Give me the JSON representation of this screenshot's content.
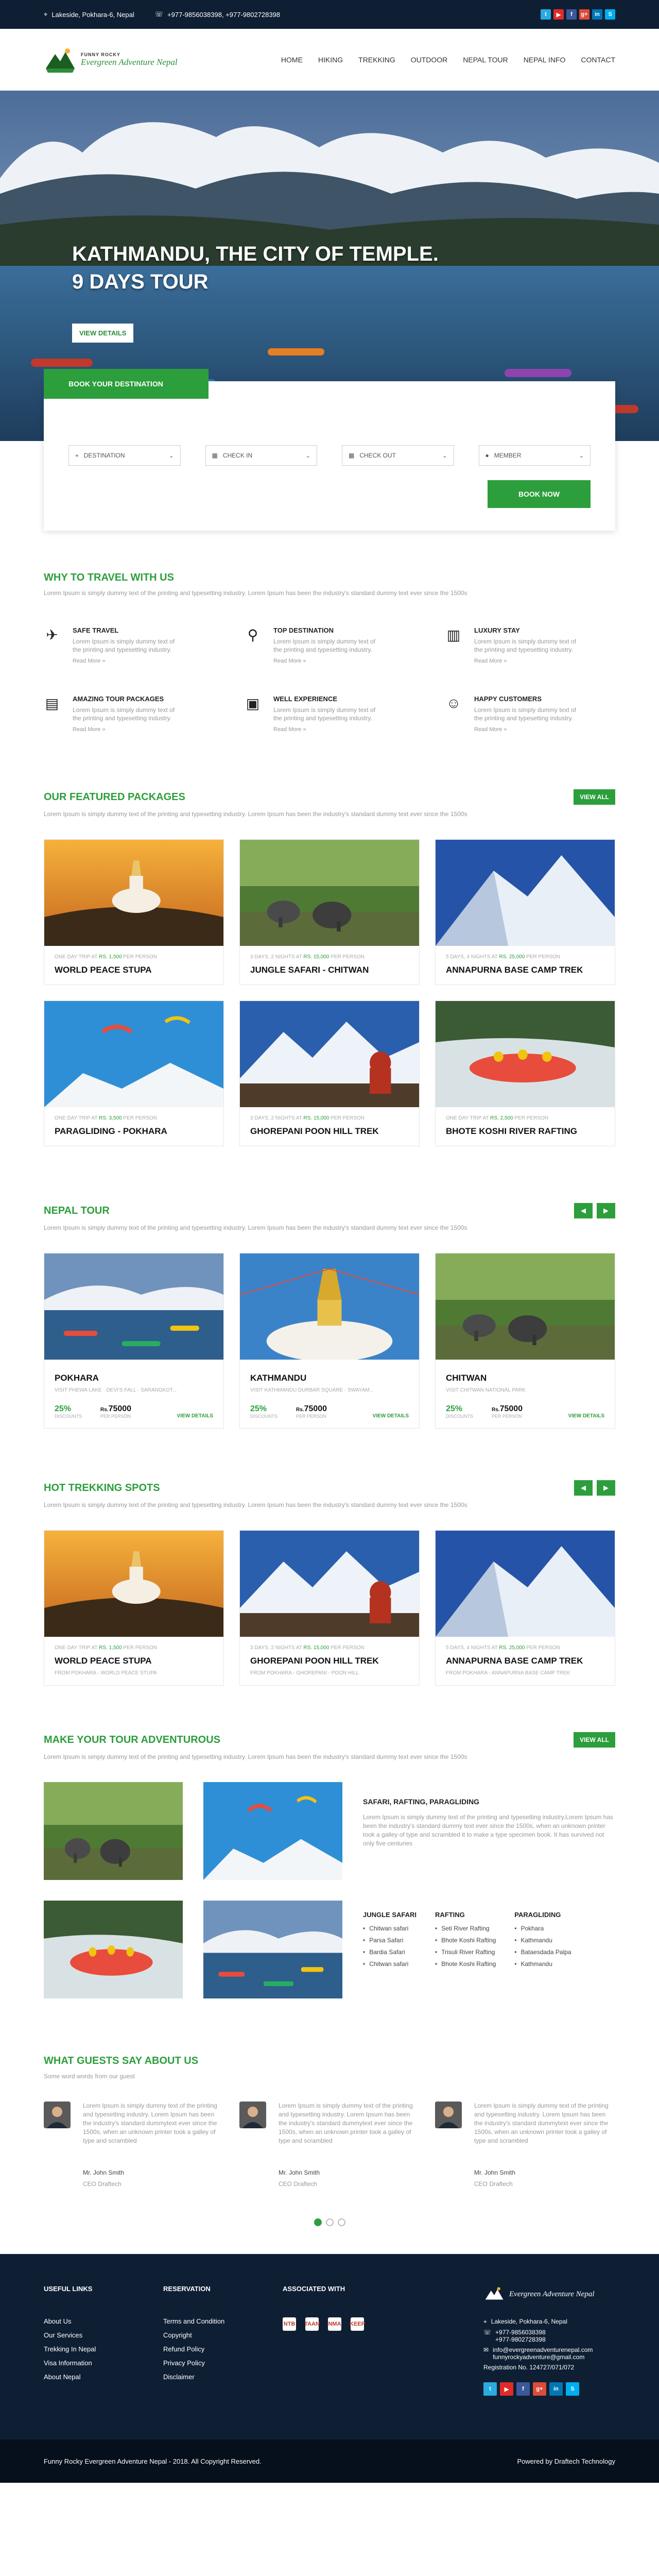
{
  "topbar": {
    "address": "Lakeside, Pokhara-6, Nepal",
    "phone": "+977-9856038398, +977-9802728398",
    "social": [
      {
        "icon": "twitter-icon",
        "glyph": "t",
        "color": "#2ba9e1"
      },
      {
        "icon": "youtube-icon",
        "glyph": "▶",
        "color": "#e12b28"
      },
      {
        "icon": "facebook-icon",
        "glyph": "f",
        "color": "#3b5998"
      },
      {
        "icon": "google-plus-icon",
        "glyph": "g+",
        "color": "#dd4b39"
      },
      {
        "icon": "linkedin-icon",
        "glyph": "in",
        "color": "#0077b5"
      },
      {
        "icon": "skype-icon",
        "glyph": "S",
        "color": "#00aff0"
      }
    ]
  },
  "nav": {
    "logo_text": "Evergreen Adventure Nepal",
    "logo_badge": "FUNNY ROCKY",
    "items": [
      "HOME",
      "HIKING",
      "TREKKING",
      "OUTDOOR",
      "NEPAL TOUR",
      "NEPAL INFO",
      "CONTACT"
    ]
  },
  "hero": {
    "title_line1": "KATHMANDU, THE CITY OF TEMPLE.",
    "title_line2": "9 DAYS TOUR",
    "button": "VIEW DETAILS"
  },
  "booking": {
    "tab": "BOOK YOUR DESTINATION",
    "fields": [
      {
        "label": "DESTINATION",
        "icon": "map-pin-icon",
        "glyph": "⌖"
      },
      {
        "label": "CHECK IN",
        "icon": "calendar-icon",
        "glyph": "▦"
      },
      {
        "label": "CHECK OUT",
        "icon": "calendar-icon",
        "glyph": "▦"
      },
      {
        "label": "MEMBER",
        "icon": "user-icon",
        "glyph": "●"
      }
    ],
    "button": "BOOK NOW"
  },
  "why": {
    "title": "WHY TO TRAVEL WITH US",
    "desc": "Lorem Ipsum is simply dummy text of the printing and typesetting industry. Lorem Ipsum has been the industry's standard dummy text ever since the 1500s",
    "items": [
      {
        "title": "SAFE TRAVEL",
        "icon": "airplane-icon",
        "glyph": "✈",
        "text": "Lorem Ipsum is simply dummy text of the printing and typesetting industry.",
        "more": "Read More »"
      },
      {
        "title": "TOP DESTINATION",
        "icon": "destination-pin-icon",
        "glyph": "⚲",
        "text": "Lorem Ipsum is simply dummy text of the printing and typesetting industry.",
        "more": "Read More »"
      },
      {
        "title": "LUXURY STAY",
        "icon": "building-icon",
        "glyph": "▥",
        "text": "Lorem Ipsum is simply dummy text of the printing and typesetting industry.",
        "more": "Read More »"
      },
      {
        "title": "AMAZING TOUR PACKAGES",
        "icon": "luggage-icon",
        "glyph": "▤",
        "text": "Lorem Ipsum is simply dummy text of the printing and typesetting industry.",
        "more": "Read More »"
      },
      {
        "title": "WELL EXPERIENCE",
        "icon": "certificate-icon",
        "glyph": "▣",
        "text": "Lorem Ipsum is simply dummy text of the printing and typesetting industry.",
        "more": "Read More »"
      },
      {
        "title": "HAPPY CUSTOMERS",
        "icon": "people-icon",
        "glyph": "☺",
        "text": "Lorem Ipsum is simply dummy text of the printing and typesetting industry.",
        "more": "Read More »"
      }
    ]
  },
  "featured": {
    "title": "OUR FEATURED PACKAGES",
    "view_all": "VIEW ALL",
    "desc": "Lorem Ipsum is simply dummy text of the printing and typesetting industry. Lorem Ipsum has been the industry's standard dummy text ever since the 1500s",
    "cards": [
      {
        "meta": "ONE DAY TRIP AT",
        "price": "RS. 1,500",
        "per": "PER PERSON",
        "title": "WORLD PEACE STUPA",
        "scene": "stupa"
      },
      {
        "meta": "3 DAYS, 2 NIGHTS AT",
        "price": "RS. 15,000",
        "per": "PER PERSON",
        "title": "JUNGLE SAFARI - CHITWAN",
        "scene": "jungle"
      },
      {
        "meta": "5 DAYS, 4 NIGHTS AT",
        "price": "RS. 25,000",
        "per": "PER PERSON",
        "title": "ANNAPURNA BASE CAMP TREK",
        "scene": "snow"
      },
      {
        "meta": "ONE DAY TRIP AT",
        "price": "RS. 3,500",
        "per": "PER PERSON",
        "title": "PARAGLIDING - POKHARA",
        "scene": "paraglide"
      },
      {
        "meta": "3 DAYS, 2 NIGHTS AT",
        "price": "RS. 15,000",
        "per": "PER PERSON",
        "title": "GHOREPANI POON HILL TREK",
        "scene": "poonhill"
      },
      {
        "meta": "ONE DAY TRIP AT",
        "price": "RS. 2,500",
        "per": "PER PERSON",
        "title": "BHOTE KOSHI RIVER RAFTING",
        "scene": "rafting"
      }
    ]
  },
  "nepal_tour": {
    "title": "NEPAL TOUR",
    "desc": "Lorem Ipsum is simply dummy text of the printing and typesetting industry. Lorem Ipsum has been the industry's standard dummy text ever since the 1500s",
    "cards": [
      {
        "title": "POKHARA",
        "route": "VISIT PHEWA LAKE · DEVI'S FALL · SARANGKOT...",
        "discount": "25%",
        "discount_label": "DISCOUNTS",
        "price": "75000",
        "currency": "Rs.",
        "price_label": "PER PERSON",
        "details": "VIEW DETAILS",
        "scene": "lake"
      },
      {
        "title": "KATHMANDU",
        "route": "VISIT KATHMANDU DURBAR SQUARE · SWAYAM...",
        "discount": "25%",
        "discount_label": "DISCOUNTS",
        "price": "75000",
        "currency": "Rs.",
        "price_label": "PER PERSON",
        "details": "VIEW DETAILS",
        "scene": "boudha"
      },
      {
        "title": "CHITWAN",
        "route": "VISIT CHITWAN NATIONAL PARK",
        "discount": "25%",
        "discount_label": "DISCOUNTS",
        "price": "75000",
        "currency": "Rs.",
        "price_label": "PER PERSON",
        "details": "VIEW DETAILS",
        "scene": "jungle"
      }
    ]
  },
  "hot_trek": {
    "title": "HOT TREKKING SPOTS",
    "desc": "Lorem Ipsum is simply dummy text of the printing and typesetting industry. Lorem Ipsum has been the industry's standard dummy text ever since the 1500s",
    "cards": [
      {
        "meta": "ONE DAY TRIP AT",
        "price": "RS. 1,500",
        "per": "PER PERSON",
        "title": "WORLD PEACE STUPA",
        "route": "FROM POKHARA - WORLD PEACE STUPA",
        "scene": "stupa"
      },
      {
        "meta": "3 DAYS, 2 NIGHTS AT",
        "price": "RS. 15,000",
        "per": "PER PERSON",
        "title": "GHOREPANI POON HILL TREK",
        "route": "FROM POKHARA - GHOREPANI - POON HILL",
        "scene": "poonhill"
      },
      {
        "meta": "5 DAYS, 4 NIGHTS AT",
        "price": "RS. 25,000",
        "per": "PER PERSON",
        "title": "ANNAPURNA BASE CAMP TREK",
        "route": "FROM POKHARA - ANNAPURNA BASE CAMP TREK",
        "scene": "snow"
      }
    ]
  },
  "adventure": {
    "title": "MAKE YOUR TOUR ADVENTUROUS",
    "view_all": "VIEW ALL",
    "desc": "Lorem Ipsum is simply dummy text of the printing and typesetting industry. Lorem Ipsum has been the industry's standard dummy text ever since the 1500s",
    "info_title": "SAFARI, RAFTING, PARAGLIDING",
    "info_text": "Lorem Ipsum is simply dummy text of the printing and typesetting industry.Lorem Ipsum has been the industry's standard dummy text ever since the 1500s, when an unknown printer took a galley of type and scrambled it to make a type specimen book. It has survived not only five centuries",
    "lists": [
      {
        "title": "JUNGLE SAFARI",
        "items": [
          "Chitwan safari",
          "Parsa Safari",
          "Bardia Safari",
          "Chitwan safari"
        ]
      },
      {
        "title": "RAFTING",
        "items": [
          "Seti River Rafting",
          "Bhote Koshi Rafting",
          "Trisuli River Rafting",
          "Bhote Koshi Rafting"
        ]
      },
      {
        "title": "PARAGLIDING",
        "items": [
          "Pokhara",
          "Kathmandu",
          "Bataesdada Palpa",
          "Kathmandu"
        ]
      }
    ]
  },
  "guests": {
    "title": "WHAT GUESTS SAY ABOUT US",
    "subtitle": "Some word words from our guest",
    "items": [
      {
        "text": "Lorem Ipsum is simply dummy text of the printing and typesetting industry. Lorem Ipsum has been the industry's standard dummytext ever since the 1500s, when an unknown printer took a galley of type and scrambled",
        "name": "Mr. John Smith",
        "role": "CEO Draftech"
      },
      {
        "text": "Lorem Ipsum is simply dummy text of the printing and typesetting industry. Lorem Ipsum has been the industry's standard dummytext ever since the 1500s, when an unknown printer took a galley of type and scrambled",
        "name": "Mr. John Smith",
        "role": "CEO Draftech"
      },
      {
        "text": "Lorem Ipsum is simply dummy text of the printing and typesetting industry. Lorem Ipsum has been the industry's standard dummytext ever since the 1500s, when an unknown printer took a galley of type and scrambled",
        "name": "Mr. John Smith",
        "role": "CEO Draftech"
      }
    ]
  },
  "footer": {
    "useful_title": "USEFUL LINKS",
    "useful": [
      "About Us",
      "Our Services",
      "Trekking In Nepal",
      "Visa Information",
      "About Nepal"
    ],
    "reservation_title": "RESERVATION",
    "reservation": [
      "Terms and Condition",
      "Copyright",
      "Refund Policy",
      "Privacy Policy",
      "Disclaimer"
    ],
    "assoc_title": "ASSOCIATED WITH",
    "assoc": [
      "NTB",
      "TAAN",
      "NMA",
      "KEEP"
    ],
    "logo_text": "Evergreen Adventure Nepal",
    "address": "Lakeside, Pokhara-6, Nepal",
    "phone1": "+977-9856038398",
    "phone2": "+977-9802728398",
    "email1": "info@evergreenadventurenepal.com",
    "email2": "funnyrockyadventure@gmail.com",
    "registration": "Registration No. 124727/071/072",
    "copyright": "Funny Rocky Evergreen Adventure Nepal - 2018. All Copyright Reserved.",
    "powered": "Powered by Draftech Technology"
  }
}
